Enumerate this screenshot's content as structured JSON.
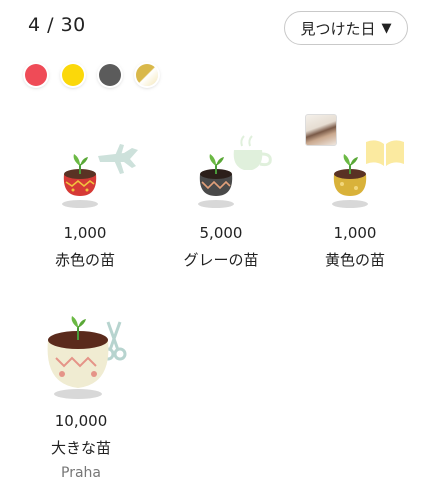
{
  "header": {
    "count": "4 / 30",
    "sort_label": "見つけた日",
    "sort_caret": "▼"
  },
  "filters": [
    {
      "name": "red",
      "color": "#ef4b57"
    },
    {
      "name": "yellow",
      "color": "#fbd80a"
    },
    {
      "name": "gray",
      "color": "#5b5b5b"
    },
    {
      "name": "gold",
      "color": "#d9b84a"
    }
  ],
  "items": [
    {
      "price": "1,000",
      "name": "赤色の苗",
      "badge_icon": "airplane-icon"
    },
    {
      "price": "5,000",
      "name": "グレーの苗",
      "badge_icon": "coffee-cup-icon"
    },
    {
      "price": "1,000",
      "name": "黄色の苗",
      "badge_icon": "book-icon"
    },
    {
      "price": "10,000",
      "name": "大きな苗",
      "owner": "Praha",
      "badge_icon": "scissors-icon"
    }
  ]
}
